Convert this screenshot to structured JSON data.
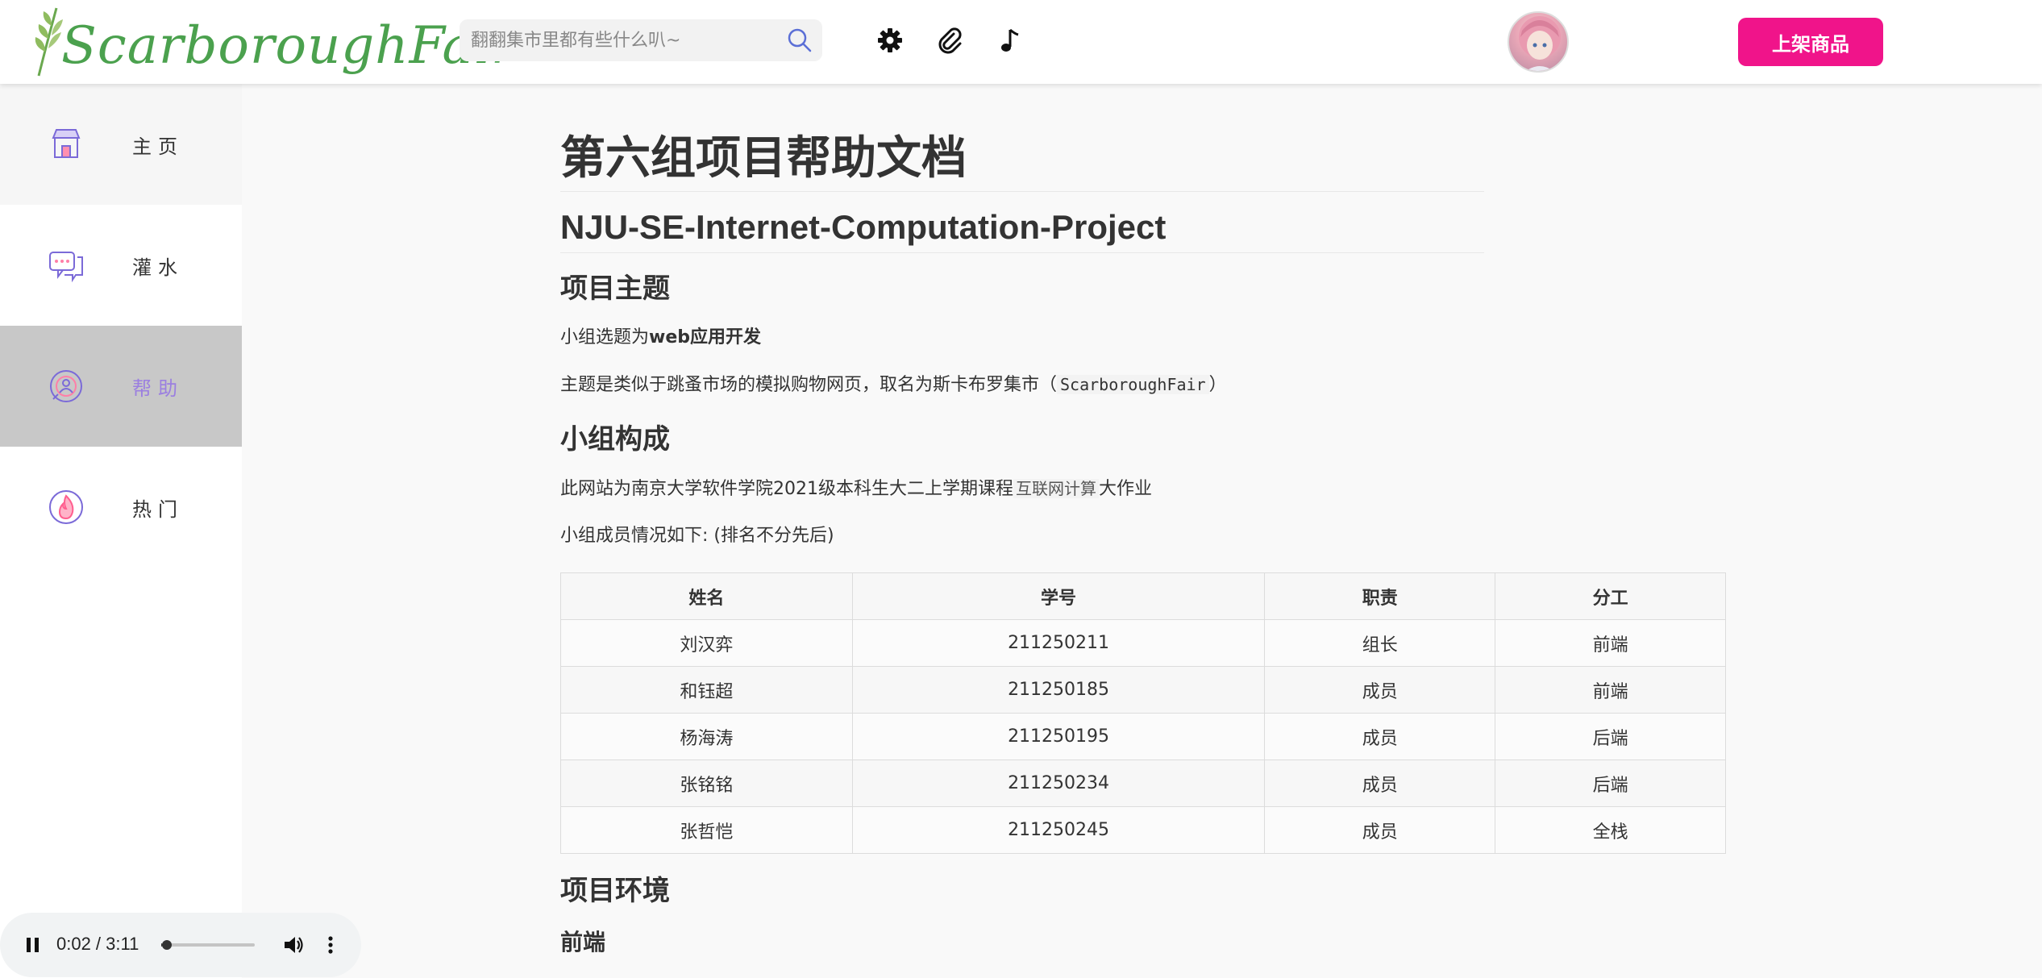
{
  "header": {
    "logo_text": "ScarboroughFair",
    "search_placeholder": "翻翻集市里都有些什么叭~",
    "publish_button": "上架商品",
    "icons": [
      "gear-icon",
      "paperclip-icon",
      "music-note-icon"
    ]
  },
  "sidebar": {
    "items": [
      {
        "label": "主页",
        "icon": "shop-icon"
      },
      {
        "label": "灌水",
        "icon": "chat-icon"
      },
      {
        "label": "帮助",
        "icon": "help-icon",
        "active": true
      },
      {
        "label": "热门",
        "icon": "flame-icon"
      }
    ]
  },
  "doc": {
    "title": "第六组项目帮助文档",
    "subtitle": "NJU-SE-Internet-Computation-Project",
    "sec_topic": "项目主题",
    "topic_p1_a": "小组选题为",
    "topic_p1_b": "web应用开发",
    "topic_p2_a": "主题是类似于跳蚤市场的模拟购物网页，取名为斯卡布罗集市（",
    "topic_p2_code": "ScarboroughFair",
    "topic_p2_b": "）",
    "sec_group": "小组构成",
    "group_p1_a": "此网站为南京大学软件学院2021级本科生大二上学期课程",
    "group_p1_code": "互联网计算",
    "group_p1_b": "大作业",
    "group_p2": "小组成员情况如下: (排名不分先后)",
    "table": {
      "headers": [
        "姓名",
        "学号",
        "职责",
        "分工"
      ],
      "rows": [
        [
          "刘汉弈",
          "211250211",
          "组长",
          "前端"
        ],
        [
          "和钰超",
          "211250185",
          "成员",
          "前端"
        ],
        [
          "杨海涛",
          "211250195",
          "成员",
          "后端"
        ],
        [
          "张铭铭",
          "211250234",
          "成员",
          "后端"
        ],
        [
          "张哲恺",
          "211250245",
          "成员",
          "全栈"
        ]
      ]
    },
    "sec_env": "项目环境",
    "sec_frontend": "前端"
  },
  "player": {
    "time": "0:02 / 3:11",
    "progress": 0.0105
  },
  "colors": {
    "accent": "#f0148a",
    "active_sidebar": "#c8c8c8",
    "active_label": "#9b7fe0",
    "logo_green": "#4ba14e"
  }
}
